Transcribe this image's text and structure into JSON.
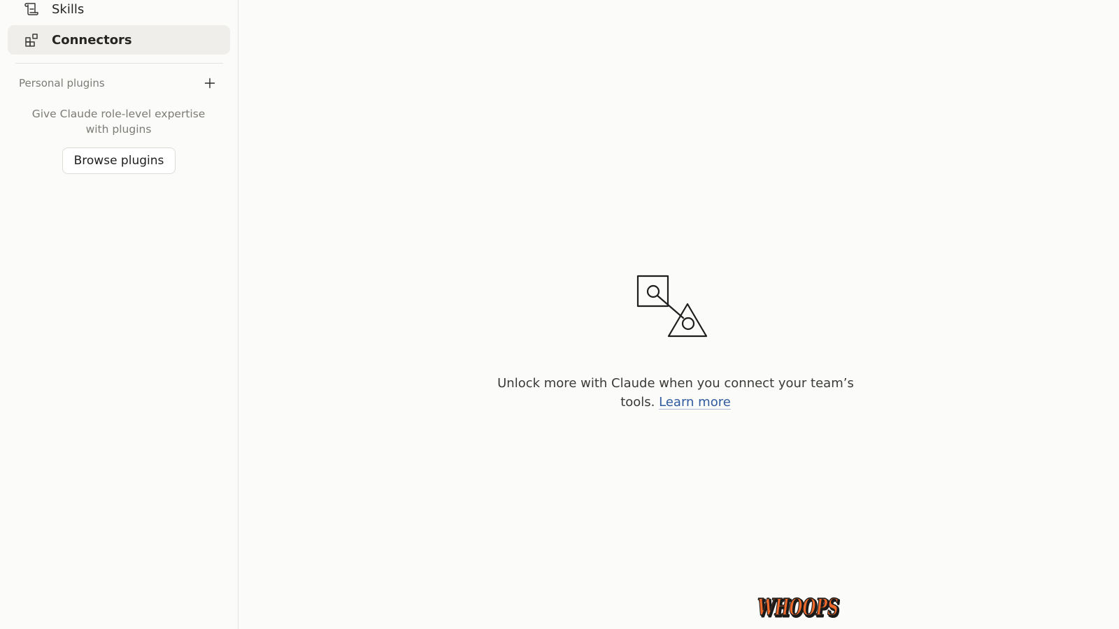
{
  "sidebar": {
    "items": [
      {
        "label": "Skills",
        "icon": "scroll-icon"
      },
      {
        "label": "Connectors",
        "icon": "connectors-icon",
        "active": true
      }
    ],
    "personal_plugins": {
      "title": "Personal plugins",
      "add_icon": "plus-icon",
      "blurb": "Give Claude role-level expertise with plugins",
      "browse_label": "Browse plugins"
    }
  },
  "main": {
    "empty_state": {
      "illustration": "search-shapes-illustration",
      "text": "Unlock more with Claude when you connect your team’s tools.",
      "link_label": "Learn more"
    }
  },
  "footer": {
    "logo_text": "WHOOPS",
    "logo_colors": {
      "fill": "#ee6a2c",
      "outline": "#1a1a1a"
    }
  },
  "colors": {
    "background": "#fbfbfa",
    "active_item": "#efeeea",
    "link": "#2f5a9e",
    "muted_text": "#7d7b76"
  }
}
